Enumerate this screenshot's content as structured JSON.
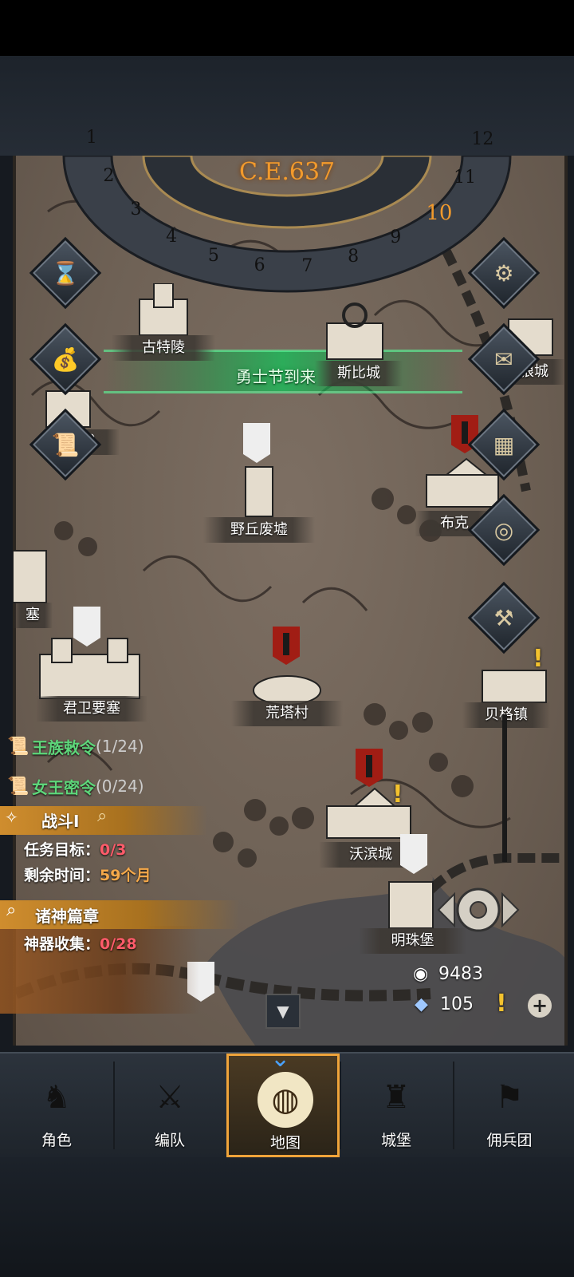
{
  "calendar": {
    "year": "C.E.637",
    "months": [
      "1",
      "2",
      "3",
      "4",
      "5",
      "6",
      "7",
      "8",
      "9",
      "10",
      "11",
      "12"
    ],
    "current_month": "10"
  },
  "event_banner": {
    "text": "勇士节到来"
  },
  "locations": [
    {
      "name": "古特陵"
    },
    {
      "name": "斯比城"
    },
    {
      "name": "城"
    },
    {
      "name": "狼城"
    },
    {
      "name": "野丘废墟"
    },
    {
      "name": "布克"
    },
    {
      "name": "塞"
    },
    {
      "name": "君卫要塞"
    },
    {
      "name": "荒塔村"
    },
    {
      "name": "贝格镇"
    },
    {
      "name": "沃滨城"
    },
    {
      "name": "明珠堡"
    }
  ],
  "side_buttons": {
    "left": [
      "hourglass-icon",
      "bag-icon",
      "scroll-icon"
    ],
    "right": [
      "gear-icon",
      "mail-icon",
      "grid-icon",
      "coin-icon",
      "hammer-icon"
    ]
  },
  "quests": {
    "royal_edict": {
      "label": "王族敕令",
      "progress": "(1/24)"
    },
    "queen_order": {
      "label": "女王密令",
      "progress": "(0/24)"
    },
    "battle": {
      "title": "战斗I",
      "objective_label": "任务目标：",
      "objective_value": "0/3",
      "time_label": "剩余时间：",
      "time_value": "59个月"
    },
    "gods": {
      "title": "诸神篇章",
      "artifact_label": "神器收集：",
      "artifact_value": "0/28"
    }
  },
  "resources": {
    "silver": "9483",
    "crystal": "105",
    "add": "+"
  },
  "bottom_nav": [
    {
      "label": "角色",
      "icon": "knight-icon"
    },
    {
      "label": "编队",
      "icon": "formation-icon"
    },
    {
      "label": "地图",
      "icon": "world-map-icon",
      "active": true
    },
    {
      "label": "城堡",
      "icon": "castle-icon"
    },
    {
      "label": "佣兵团",
      "icon": "mercenary-icon"
    }
  ],
  "colors": {
    "accent": "#f0a43a",
    "quest_green": "#5dd67a",
    "progress_red": "#ff5b6a",
    "event_glow": "#0f8a3a",
    "banner_red": "#a11d14"
  }
}
